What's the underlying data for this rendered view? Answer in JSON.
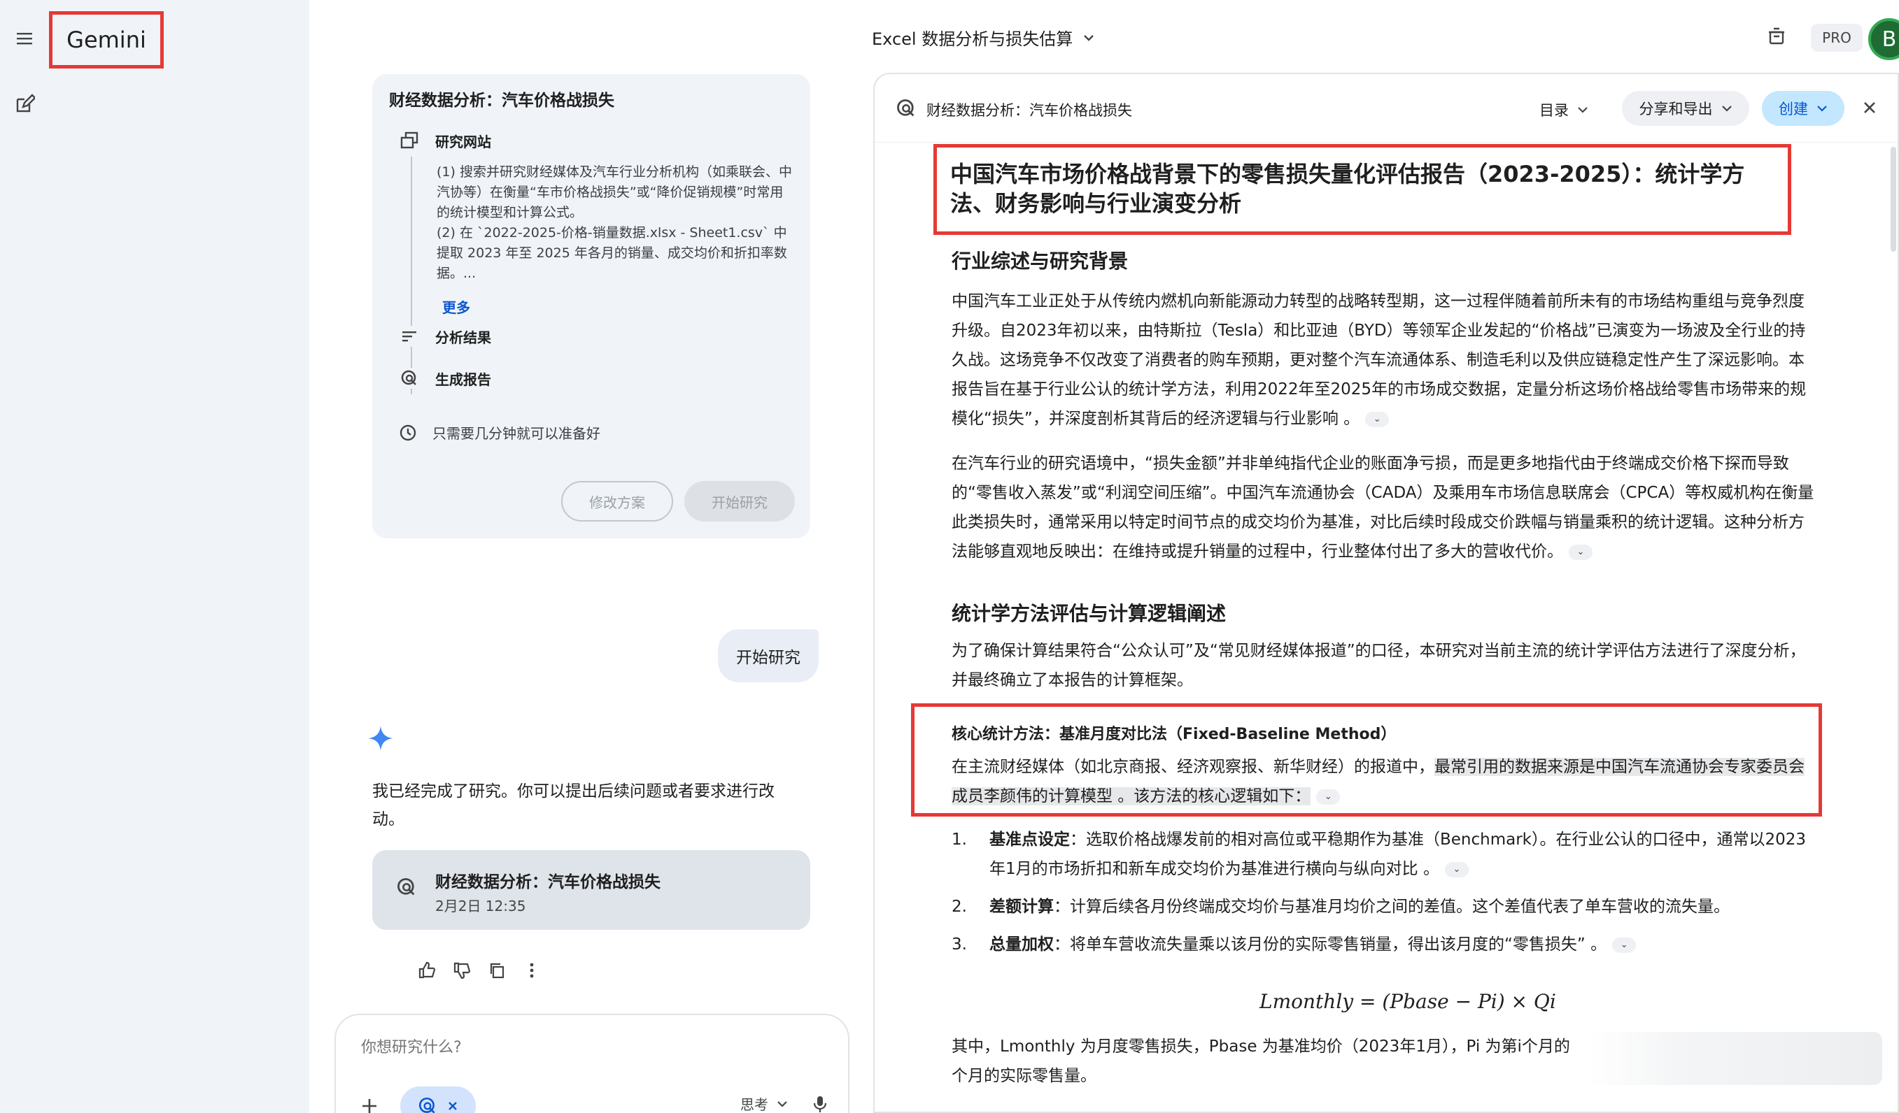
{
  "sidebar": {
    "brand": "Gemini"
  },
  "chat": {
    "plan": {
      "title": "财经数据分析：汽车价格战损失",
      "steps": {
        "research_sites": "研究网站",
        "analysis": "分析结果",
        "report": "生成报告"
      },
      "description": "(1) 搜索并研究财经媒体及汽车行业分析机构（如乘联会、中汽协等）在衡量“车市价格战损失”或“降价促销规模”时常用的统计模型和计算公式。\n(2) 在 `2022-2025-价格-销量数据.xlsx - Sheet1.csv` 中提取 2023 年至 2025 年各月的销量、成交均价和折扣率数据。...",
      "more": "更多",
      "note": "只需要几分钟就可以准备好",
      "edit_button": "修改方案",
      "start_button": "开始研究"
    },
    "user_message": "开始研究",
    "assistant_reply": "我已经完成了研究。你可以提出后续问题或者要求进行改动。",
    "report_chip": {
      "title": "财经数据分析：汽车价格战损失",
      "date": "2月2日 12:35"
    },
    "input": {
      "placeholder": "你想研究什么?",
      "mode": "思考"
    }
  },
  "header": {
    "title": "Excel 数据分析与损失估算",
    "pro": "PRO",
    "avatar": "B"
  },
  "panel": {
    "title": "财经数据分析：汽车价格战损失",
    "toc": "目录",
    "share": "分享和导出",
    "create": "创建"
  },
  "report": {
    "title": "中国汽车市场价格战背景下的零售损失量化评估报告（2023-2025）：统计学方法、财务影响与行业演变分析",
    "section1": "行业综述与研究背景",
    "p1": "中国汽车工业正处于从传统内燃机向新能源动力转型的战略转型期，这一过程伴随着前所未有的市场结构重组与竞争烈度升级。自2023年初以来，由特斯拉（Tesla）和比亚迪（BYD）等领军企业发起的“价格战”已演变为一场波及全行业的持久战。这场竞争不仅改变了消费者的购车预期，更对整个汽车流通体系、制造毛利以及供应链稳定性产生了深远影响。本报告旨在基于行业公认的统计学方法，利用2022年至2025年的市场成交数据，定量分析这场价格战给零售市场带来的规模化“损失”，并深度剖析其背后的经济逻辑与行业影响 。",
    "p2": "在汽车行业的研究语境中，“损失金额”并非单纯指代企业的账面净亏损，而是更多地指代由于终端成交价格下探而导致的“零售收入蒸发”或“利润空间压缩”。中国汽车流通协会（CADA）及乘用车市场信息联席会（CPCA）等权威机构在衡量此类损失时，通常采用以特定时间节点的成交均价为基准，对比后续时段成交价跌幅与销量乘积的统计逻辑。这种分析方法能够直观地反映出：在维持或提升销量的过程中，行业整体付出了多大的营收代价。",
    "section2": "统计学方法评估与计算逻辑阐述",
    "p3": "为了确保计算结果符合“公众认可”及“常见财经媒体报道”的口径，本研究对当前主流的统计学评估方法进行了深度分析，并最终确立了本报告的计算框架。",
    "h3": "核心统计方法：基准月度对比法（Fixed-Baseline Method）",
    "p4_plain": "在主流财经媒体（如北京商报、经济观察报、新华财经）的报道中，",
    "p4_hl": "最常引用的数据来源是中国汽车流通协会专家委员会成员李颜伟的计算模型 。该方法的核心逻辑如下：",
    "list": [
      {
        "num": "1.",
        "bold": "基准点设定",
        "text": "：选取价格战爆发前的相对高位或平稳期作为基准（Benchmark）。在行业公认的口径中，通常以2023年1月的市场折扣和新车成交均价为基准进行横向与纵向对比 。"
      },
      {
        "num": "2.",
        "bold": "差额计算",
        "text": "：计算后续各月份终端成交均价与基准月均价之间的差值。这个差值代表了单车营收的流失量。"
      },
      {
        "num": "3.",
        "bold": "总量加权",
        "text": "：将单车营收流失量乘以该月份的实际零售销量，得出该月度的“零售损失” 。"
      }
    ],
    "formula": "Lmonthly = (Pbase − Pi) × Qi",
    "p5": "其中，Lmonthly 为月度零售损失，Pbase 为基准均价（2023年1月），Pi 为第i个月的",
    "p5b": "个月的实际零售量。"
  }
}
